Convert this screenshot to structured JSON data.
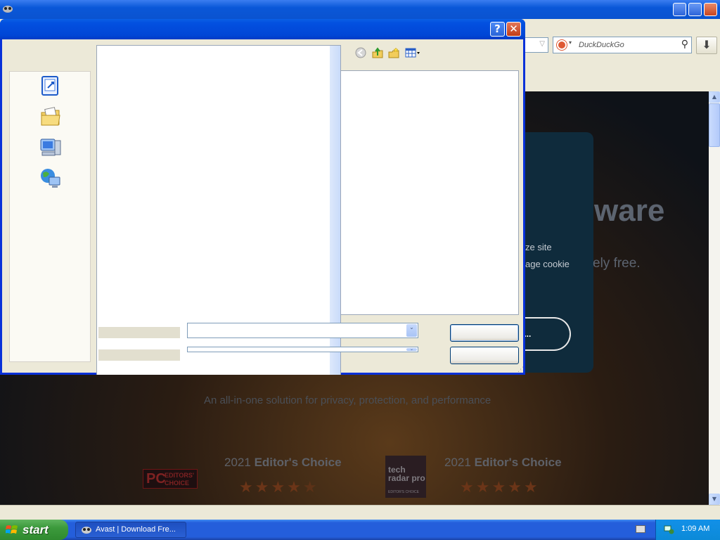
{
  "browser": {
    "search_placeholder": "DuckDuckGo"
  },
  "web_page": {
    "hero_heading_partial": "ware",
    "hero_card_line1": "ze site",
    "hero_card_line2": "age cookie",
    "hero_sub_partial": "ely free.",
    "manage_button_partial": "GE...",
    "tagline": "An all-in-one solution for privacy, protection, and performance",
    "award_left": {
      "year": "2021",
      "title": "Editor's Choice",
      "stars": 4.5,
      "badge_line1": "EDITORS'",
      "badge_line2": "CHOICE",
      "badge_logo": "PC"
    },
    "award_right": {
      "year": "2021",
      "title": "Editor's Choice",
      "stars": 5,
      "badge_line1": "tech",
      "badge_line2": "radar pro",
      "badge_footer": "EDITOR'S CHOICE"
    }
  },
  "dialog": {
    "help_label": "?",
    "close_label": "✕",
    "places": [
      "recent-documents-icon",
      "my-documents-icon",
      "my-computer-icon",
      "network-places-icon"
    ],
    "nav_icons": [
      "back-icon",
      "up-folder-icon",
      "new-folder-icon",
      "views-icon"
    ]
  },
  "taskbar": {
    "start_label": "start",
    "task_label": "Avast | Download Fre...",
    "clock": "1:09 AM"
  },
  "colors": {
    "xp_blue": "#0a53d0",
    "dialog_face": "#ece9d8",
    "start_green": "#3c9a3c",
    "tray_blue": "#0c8ad8",
    "star_orange": "#6b3518"
  }
}
